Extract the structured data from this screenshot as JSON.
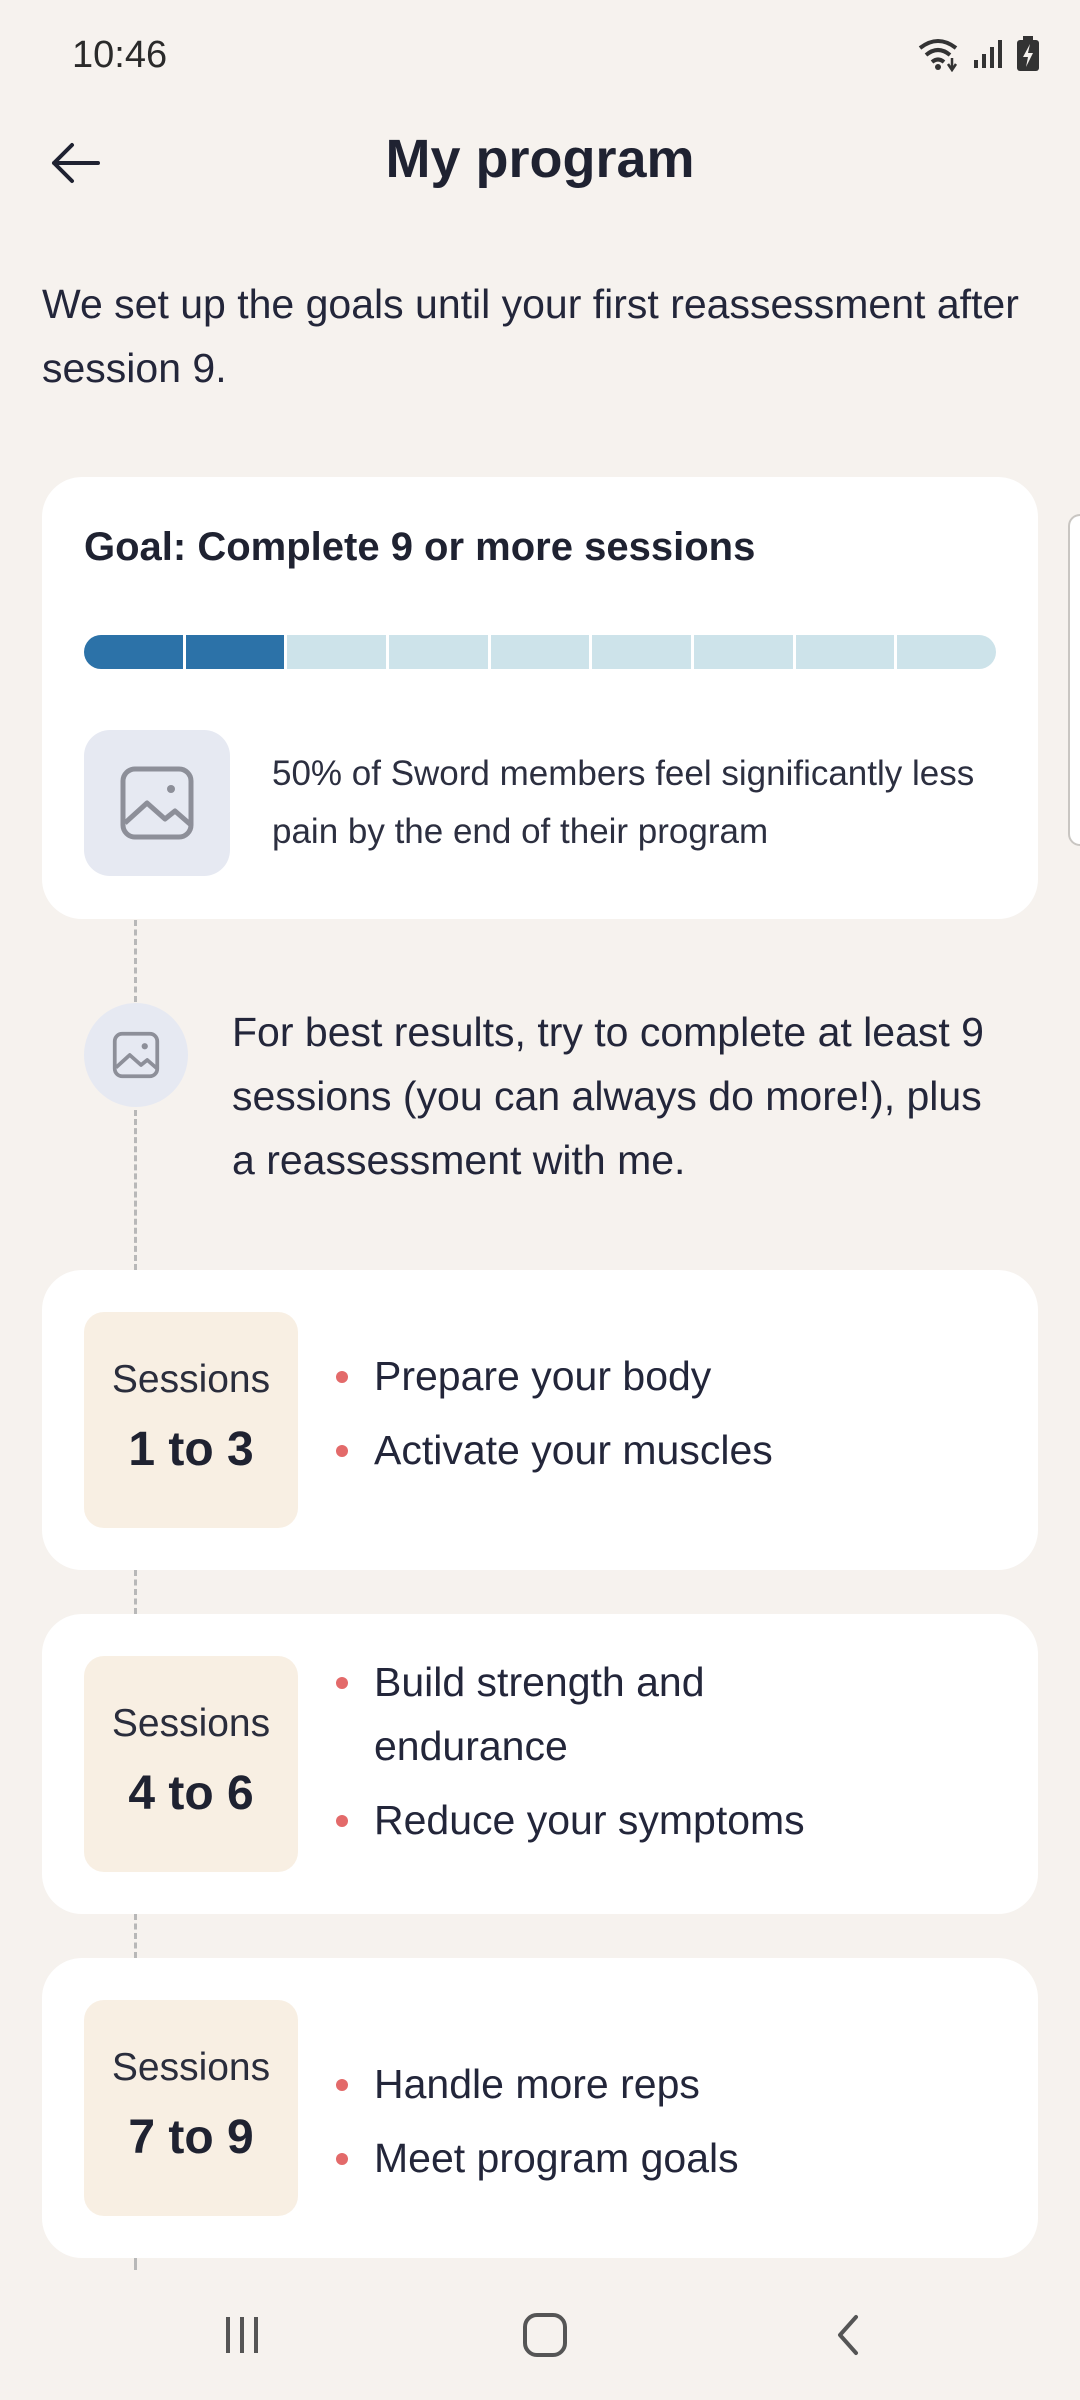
{
  "status_bar": {
    "time": "10:46",
    "icons": [
      "wifi-icon",
      "signal-icon",
      "battery-charging-icon"
    ]
  },
  "header": {
    "title": "My program",
    "back_icon": "arrow-left-icon"
  },
  "intro": "We set up the goals until your first reassessment after session 9.",
  "goal": {
    "title": "Goal: Complete 9 or more sessions",
    "progress": {
      "completed": 2,
      "total": 9
    },
    "tip_icon": "image-placeholder-icon",
    "tip": "50% of Sword members feel significantly less pain by the end of their program"
  },
  "coach": {
    "avatar_icon": "image-placeholder-icon",
    "message": "For best results, try to complete at least 9 sessions (you can always do more!), plus a reassessment with me."
  },
  "sessions": [
    {
      "label": "Sessions",
      "range": "1 to 3",
      "items": [
        "Prepare your body",
        "Activate your muscles"
      ]
    },
    {
      "label": "Sessions",
      "range": "4 to 6",
      "items": [
        "Build strength and endurance",
        "Reduce your symptoms"
      ]
    },
    {
      "label": "Sessions",
      "range": "7 to 9",
      "items": [
        "Handle more reps",
        "Meet program goals"
      ]
    }
  ],
  "nav_bar": {
    "icons": [
      "recent-apps-icon",
      "home-icon",
      "back-icon"
    ]
  },
  "colors": {
    "background": "#f6f2ee",
    "progress_done": "#2c72a8",
    "progress_todo": "#cde3ea",
    "bullet": "#e36a6a",
    "badge": "#f8efe3"
  }
}
